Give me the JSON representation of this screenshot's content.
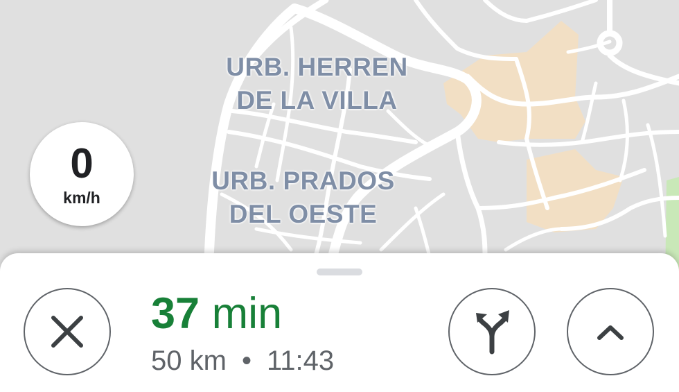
{
  "map": {
    "areas": [
      {
        "name": "area-urb-herren",
        "lines": [
          "URB. HERREN",
          "DE LA VILLA"
        ]
      },
      {
        "name": "area-urb-prados",
        "lines": [
          "URB. PRADOS",
          "DEL OESTE"
        ]
      }
    ],
    "colors": {
      "background": "#e0e0e0",
      "road": "#ffffff",
      "built_area": "#f2dfc4",
      "park": "#c9e8b8",
      "label": "#7f8ea6"
    }
  },
  "speedometer": {
    "value": "0",
    "unit": "km/h"
  },
  "trip": {
    "eta_value": "37",
    "eta_unit": "min",
    "distance": "50 km",
    "separator": "•",
    "arrival_time": "11:43",
    "eta_color": "#188038"
  },
  "icons": {
    "close": "close-icon",
    "alternate_routes": "fork-arrows-icon",
    "expand": "chevron-up-icon"
  }
}
